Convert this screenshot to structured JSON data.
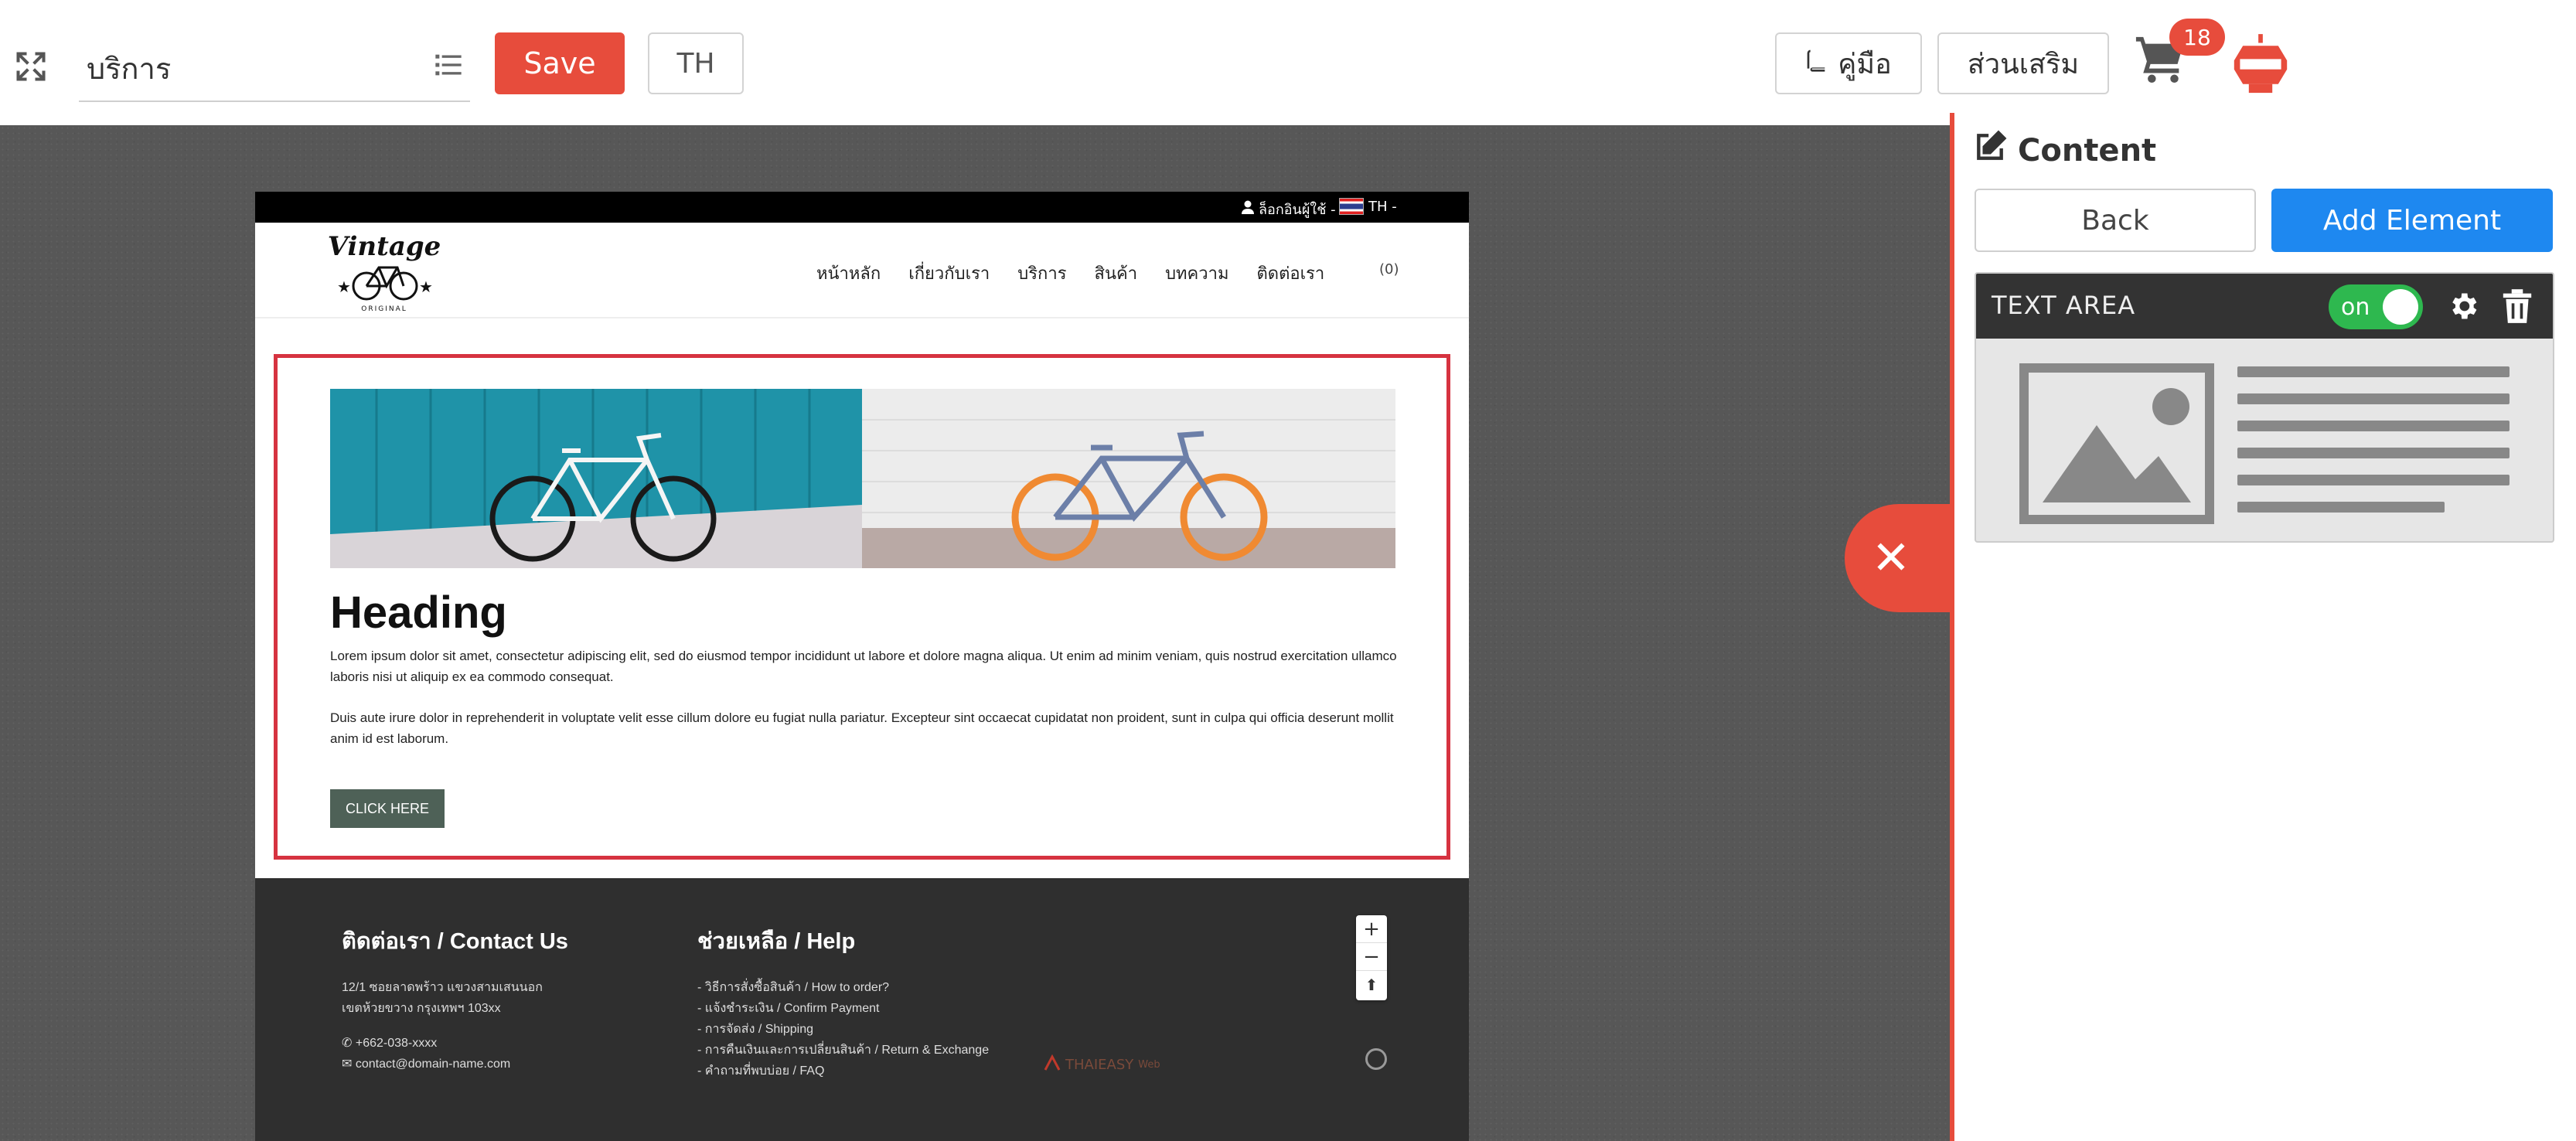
{
  "toolbar": {
    "page_name": "บริการ",
    "save_label": "Save",
    "language_label": "TH",
    "manual_label": "คู่มือ",
    "addons_label": "ส่วนเสริม",
    "cart_count": "18"
  },
  "site": {
    "top_login": "ล็อกอินผู้ใช้ -",
    "top_lang": "TH -",
    "logo_text": "Vintage",
    "logo_sub": "ORIGINAL",
    "nav": [
      "หน้าหลัก",
      "เกี่ยวกับเรา",
      "บริการ",
      "สินค้า",
      "บทความ",
      "ติดต่อเรา"
    ],
    "cart_count": "(0)",
    "section": {
      "heading": "Heading",
      "paragraph1": "Lorem ipsum dolor sit amet, consectetur adipiscing elit, sed do eiusmod tempor incididunt ut labore et dolore magna aliqua. Ut enim ad minim veniam, quis nostrud exercitation ullamco laboris nisi ut aliquip ex ea commodo consequat.",
      "paragraph2": "Duis aute irure dolor in reprehenderit in voluptate velit esse cillum dolore eu fugiat nulla pariatur. Excepteur sint occaecat cupidatat non proident, sunt in culpa qui officia deserunt mollit anim id est laborum.",
      "button": "CLICK HERE"
    },
    "footer": {
      "contact_title": "ติดต่อเรา / Contact Us",
      "address1": "12/1 ซอยลาดพร้าว แขวงสามเสนนอก",
      "address2": "เขตห้วยขวาง กรุงเทพฯ 103xx",
      "phone": "+662-038-xxxx",
      "email": "contact@domain-name.com",
      "help_title": "ช่วยเหลือ / Help",
      "help_items": [
        "- วิธีการสั่งซื้อสินค้า / How to order?",
        "- แจ้งชำระเงิน / Confirm Payment",
        "- การจัดส่ง / Shipping",
        "- การคืนเงินและการเปลี่ยนสินค้า / Return & Exchange",
        "- คำถามที่พบบ่อย / FAQ"
      ],
      "powered": "THAIEASY",
      "powered_suffix": "Web"
    }
  },
  "panel": {
    "title": "Content",
    "back_label": "Back",
    "add_label": "Add Element",
    "card_title": "TEXT AREA",
    "toggle_label": "on"
  },
  "colors": {
    "accent_red": "#e74c3c",
    "primary_blue": "#1e88f0",
    "toggle_green": "#2eb84f",
    "section_outline": "#d63340"
  }
}
